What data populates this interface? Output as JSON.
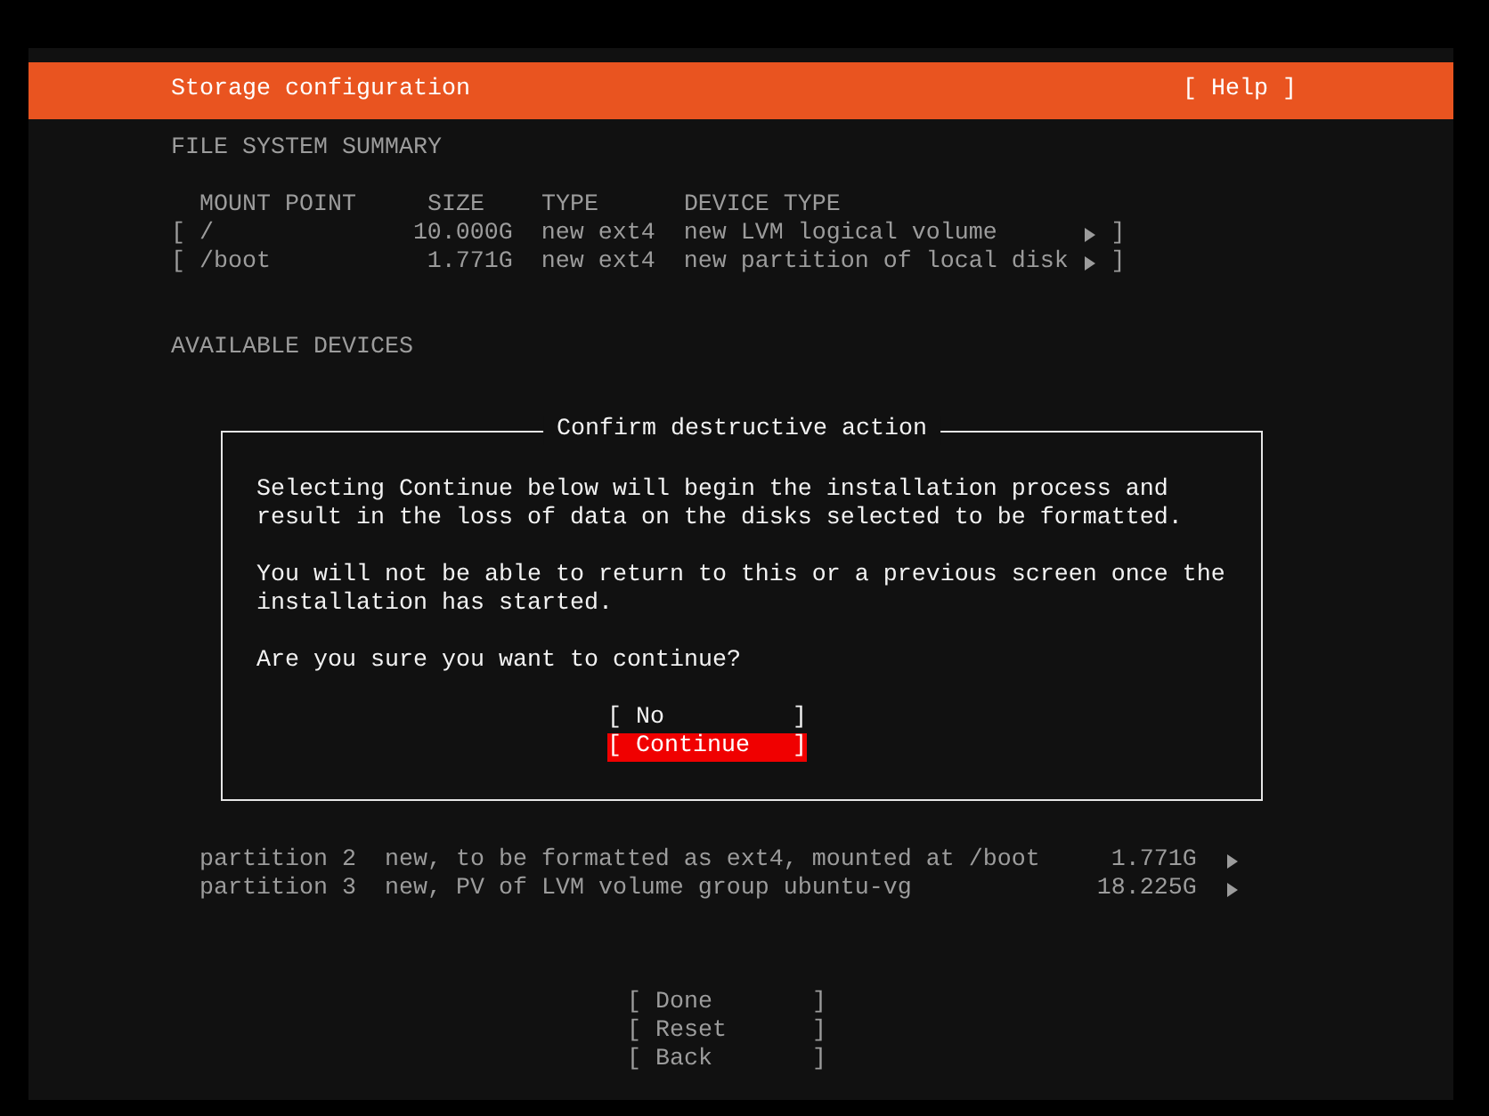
{
  "header": {
    "title": "Storage configuration",
    "help": "[ Help ]"
  },
  "file_system_summary": {
    "heading": "FILE SYSTEM SUMMARY",
    "columns": [
      "MOUNT POINT",
      "SIZE",
      "TYPE",
      "DEVICE TYPE"
    ],
    "rows": [
      {
        "open": "[",
        "mount_point": "/",
        "size": "10.000G",
        "type": "new ext4",
        "device_type": "new LVM logical volume",
        "close": "]"
      },
      {
        "open": "[",
        "mount_point": "/boot",
        "size": "1.771G",
        "type": "new ext4",
        "device_type": "new partition of local disk",
        "close": "]"
      }
    ]
  },
  "available_devices": {
    "heading": "AVAILABLE DEVICES",
    "partitions": [
      {
        "name": "partition 2",
        "description": "new, to be formatted as ext4, mounted at /boot",
        "size": "1.771G"
      },
      {
        "name": "partition 3",
        "description": "new, PV of LVM volume group ubuntu-vg",
        "size": "18.225G"
      }
    ]
  },
  "buttons": [
    {
      "label": "[ Done       ]"
    },
    {
      "label": "[ Reset      ]"
    },
    {
      "label": "[ Back       ]"
    }
  ],
  "dialog": {
    "title": "Confirm destructive action",
    "paragraphs": [
      "Selecting Continue below will begin the installation process and result in the loss of data on the disks selected to be formatted.",
      "You will not be able to return to this or a previous screen once the installation has started.",
      "Are you sure you want to continue?"
    ],
    "buttons": [
      {
        "label": "[ No         ]",
        "selected": false
      },
      {
        "label": "[ Continue   ]",
        "selected": true
      }
    ]
  }
}
